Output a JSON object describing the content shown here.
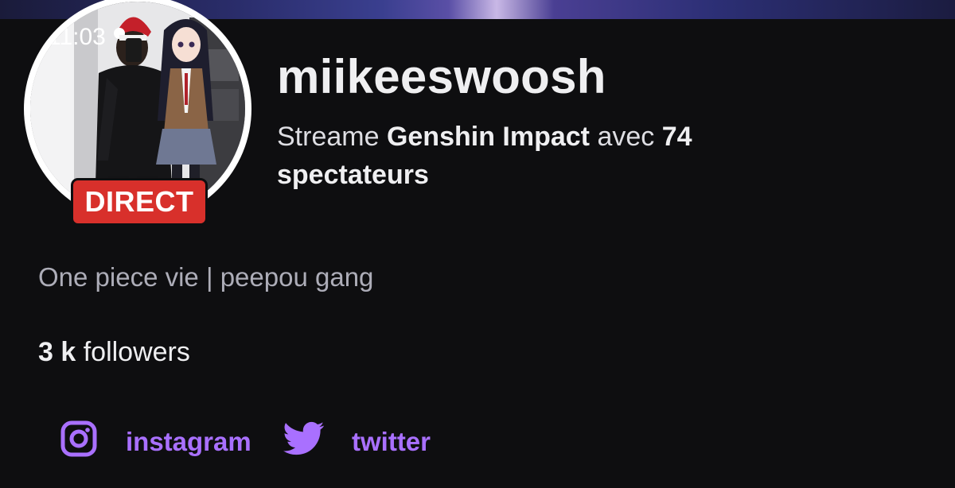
{
  "avatar": {
    "time_text": "11:03"
  },
  "live_badge": {
    "label": "DIRECT",
    "color": "#d8302b"
  },
  "channel": {
    "name": "miikeeswoosh",
    "streaming_prefix": "Streame",
    "game": "Genshin Impact",
    "with_text": "avec",
    "viewer_count": "74",
    "viewers_label": "spectateurs"
  },
  "bio": "One piece vie | peepou gang",
  "followers": {
    "count": "3 k",
    "label": "followers"
  },
  "social_links": [
    {
      "label": "instagram",
      "icon": "instagram-icon"
    },
    {
      "label": "twitter",
      "icon": "twitter-icon"
    }
  ],
  "accent_color": "#a970ff"
}
